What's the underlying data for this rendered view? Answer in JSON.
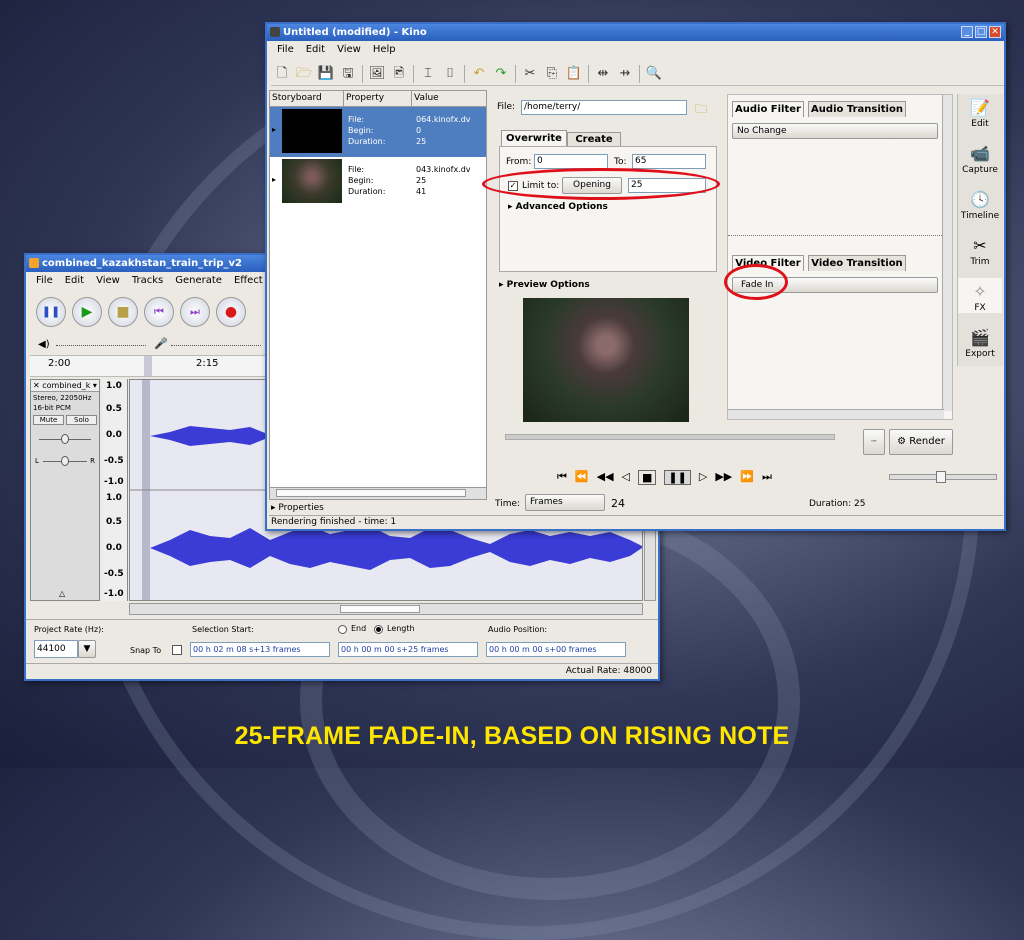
{
  "caption": "25-FRAME FADE-IN, BASED ON RISING NOTE",
  "audacity": {
    "title": "combined_kazakhstan_train_trip_v2",
    "menu": [
      "File",
      "Edit",
      "View",
      "Tracks",
      "Generate",
      "Effect",
      "An"
    ],
    "ruler": [
      "2:00",
      "2:15"
    ],
    "track": {
      "name": "combined_k",
      "info1": "Stereo, 22050Hz",
      "info2": "16-bit PCM",
      "mute": "Mute",
      "solo": "Solo",
      "l": "L",
      "r": "R"
    },
    "scale1": [
      "1.0",
      "0.5",
      "0.0",
      "-0.5",
      "-1.0"
    ],
    "scale2": [
      "1.0",
      "0.5",
      "0.0",
      "-0.5",
      "-1.0"
    ],
    "project_rate_label": "Project Rate (Hz):",
    "project_rate": "44100",
    "snap_to": "Snap To",
    "selection_start_label": "Selection Start:",
    "selection_start": "00 h 02 m 08 s+13 frames",
    "end_label": "End",
    "length_label": "Length",
    "length_value": "00 h 00 m 00 s+25 frames",
    "audio_position_label": "Audio Position:",
    "audio_position": "00 h 00 m 00 s+00 frames",
    "actual_rate": "Actual Rate: 48000",
    "colors": {
      "wave": "#3b3bd6",
      "bg": "#e4e4ef"
    }
  },
  "kino": {
    "title": "Untitled (modified)  - Kino",
    "menu": [
      "File",
      "Edit",
      "View",
      "Help"
    ],
    "storyboard_headers": [
      "Storyboard",
      "Property",
      "Value"
    ],
    "clips": [
      {
        "k1": "File:",
        "v1": "064.kinofx.dv",
        "k2": "Begin:",
        "v2": "0",
        "k3": "Duration:",
        "v3": "25"
      },
      {
        "k1": "File:",
        "v1": "043.kinofx.dv",
        "k2": "Begin:",
        "v2": "25",
        "k3": "Duration:",
        "v3": "41"
      }
    ],
    "properties_label": "Properties",
    "status": "Rendering finished - time: 1",
    "file_label": "File:",
    "file_value": "/home/terry/",
    "tab_overwrite": "Overwrite",
    "tab_create": "Create",
    "from_label": "From:",
    "from_value": "0",
    "to_label": "To:",
    "to_value": "65",
    "limit_label": "Limit to:",
    "limit_select": "Opening",
    "limit_value": "25",
    "advanced": "Advanced Options",
    "preview": "Preview Options",
    "audio_filter_tab": "Audio Filter",
    "audio_transition_tab": "Audio Transition",
    "audio_filter_value": "No Change",
    "video_filter_tab": "Video Filter",
    "video_transition_tab": "Video Transition",
    "video_filter_value": "Fade In",
    "render": "Render",
    "time_label": "Time:",
    "time_unit": "Frames",
    "time_value": "24",
    "duration": "Duration: 25",
    "side": [
      "Edit",
      "Capture",
      "Timeline",
      "Trim",
      "FX",
      "Export"
    ]
  }
}
